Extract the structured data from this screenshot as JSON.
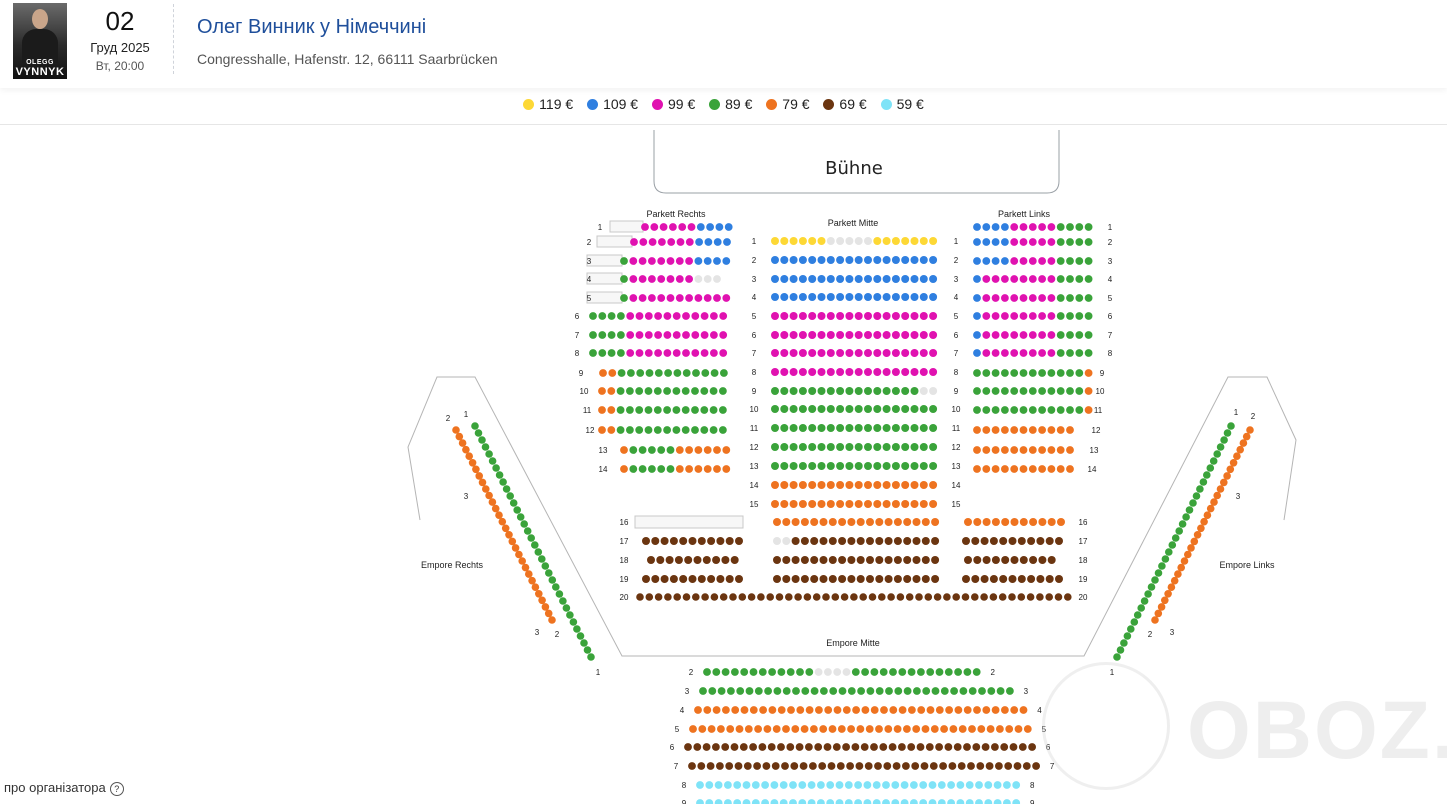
{
  "event": {
    "poster": {
      "line1": "OLEGG",
      "line2": "VYNNYK"
    },
    "day": "02",
    "month_year": "Груд 2025",
    "weekday_time": "Вт, 20:00",
    "title": "Олег Винник у Німеччині",
    "venue": "Congresshalle, Hafenstr. 12, 66111 Saarbrücken"
  },
  "legend": [
    {
      "price": "119 €",
      "color": "#fdd835"
    },
    {
      "price": "109 €",
      "color": "#2f7fe0"
    },
    {
      "price": "99 €",
      "color": "#e012b0"
    },
    {
      "price": "89 €",
      "color": "#3aa33a"
    },
    {
      "price": "79 €",
      "color": "#ee7320"
    },
    {
      "price": "69 €",
      "color": "#6b3510"
    },
    {
      "price": "59 €",
      "color": "#7fe3f7"
    }
  ],
  "plan": {
    "stage": "Bühne",
    "sections": {
      "parkett_rechts": "Parkett Rechts",
      "parkett_mitte": "Parkett Mitte",
      "parkett_links": "Parkett Links",
      "empore_rechts": "Empore Rechts",
      "empore_links": "Empore Links",
      "empore_mitte": "Empore Mitte"
    }
  },
  "footer": {
    "about": "про організатора"
  },
  "watermark": "OBOZ.UA"
}
